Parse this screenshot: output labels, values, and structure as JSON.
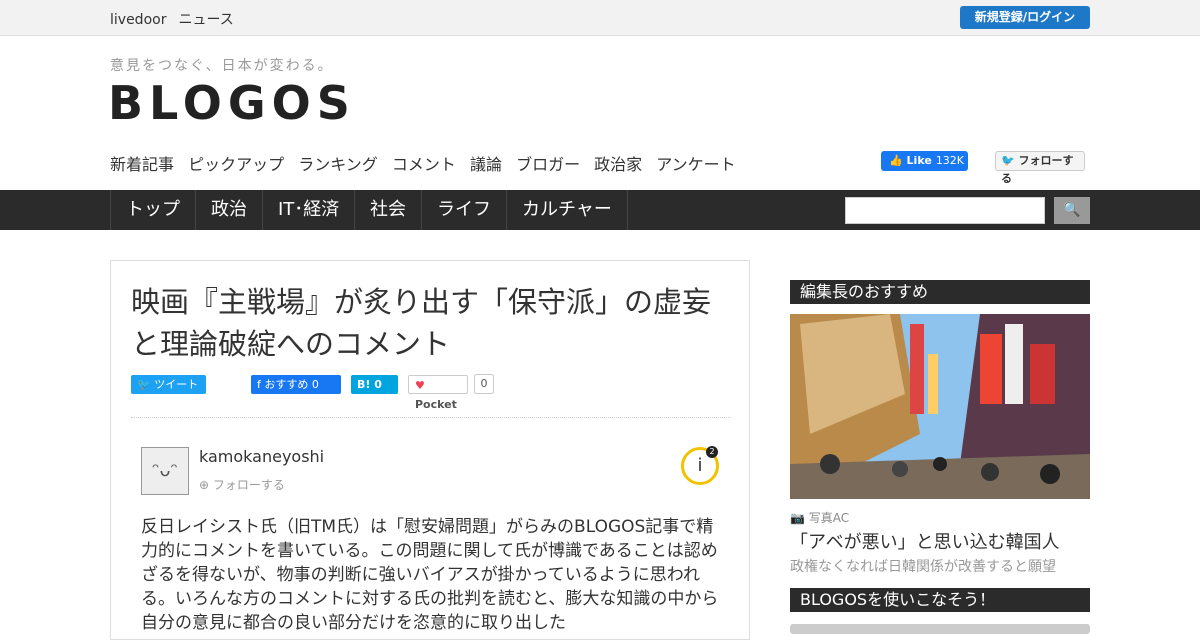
{
  "topbar": {
    "livedoor": "livedoor",
    "news": "ニュース",
    "login": "新規登録/ログイン"
  },
  "header": {
    "tagline": "意見をつなぐ、日本が変わる。",
    "logo": "BLOGOS",
    "subnav": [
      "新着記事",
      "ピックアップ",
      "ランキング",
      "コメント",
      "議論",
      "ブロガー",
      "政治家",
      "アンケート"
    ],
    "fb_like": "Like",
    "fb_count": "132K",
    "tw_follow": "フォローする"
  },
  "mainnav": [
    "トップ",
    "政治",
    "IT･経済",
    "社会",
    "ライフ",
    "カルチャー"
  ],
  "search": {
    "button": "🔍"
  },
  "article": {
    "title": "映画『主戦場』が炙り出す「保守派」の虚妄と理論破綻へのコメント",
    "share": {
      "tweet": "ツイート",
      "fb": "おすすめ 0",
      "hatena": "B! 0",
      "pocket": "Pocket",
      "pocket_count": "0"
    },
    "author": "kamokaneyoshi",
    "follow": "フォローする",
    "badge_count": "2",
    "body": "反日レイシスト氏（旧TM氏）は「慰安婦問題」がらみのBLOGOS記事で精力的にコメントを書いている。この問題に関して氏が博識であることは認めざるを得ないが、物事の判断に強いバイアスが掛かっているように思われる。いろんな方のコメントに対する氏の批判を読むと、膨大な知識の中から自分の意見に都合の良い部分だけを恣意的に取り出した"
  },
  "sidebar": {
    "heading": "編集長のおすすめ",
    "photo_credit": "写真AC",
    "featured_title": "「アベが悪い」と思い込む韓国人",
    "featured_sub": "政権なくなれば日韓関係が改善すると願望",
    "heading2": "BLOGOSを使いこなそう！"
  }
}
